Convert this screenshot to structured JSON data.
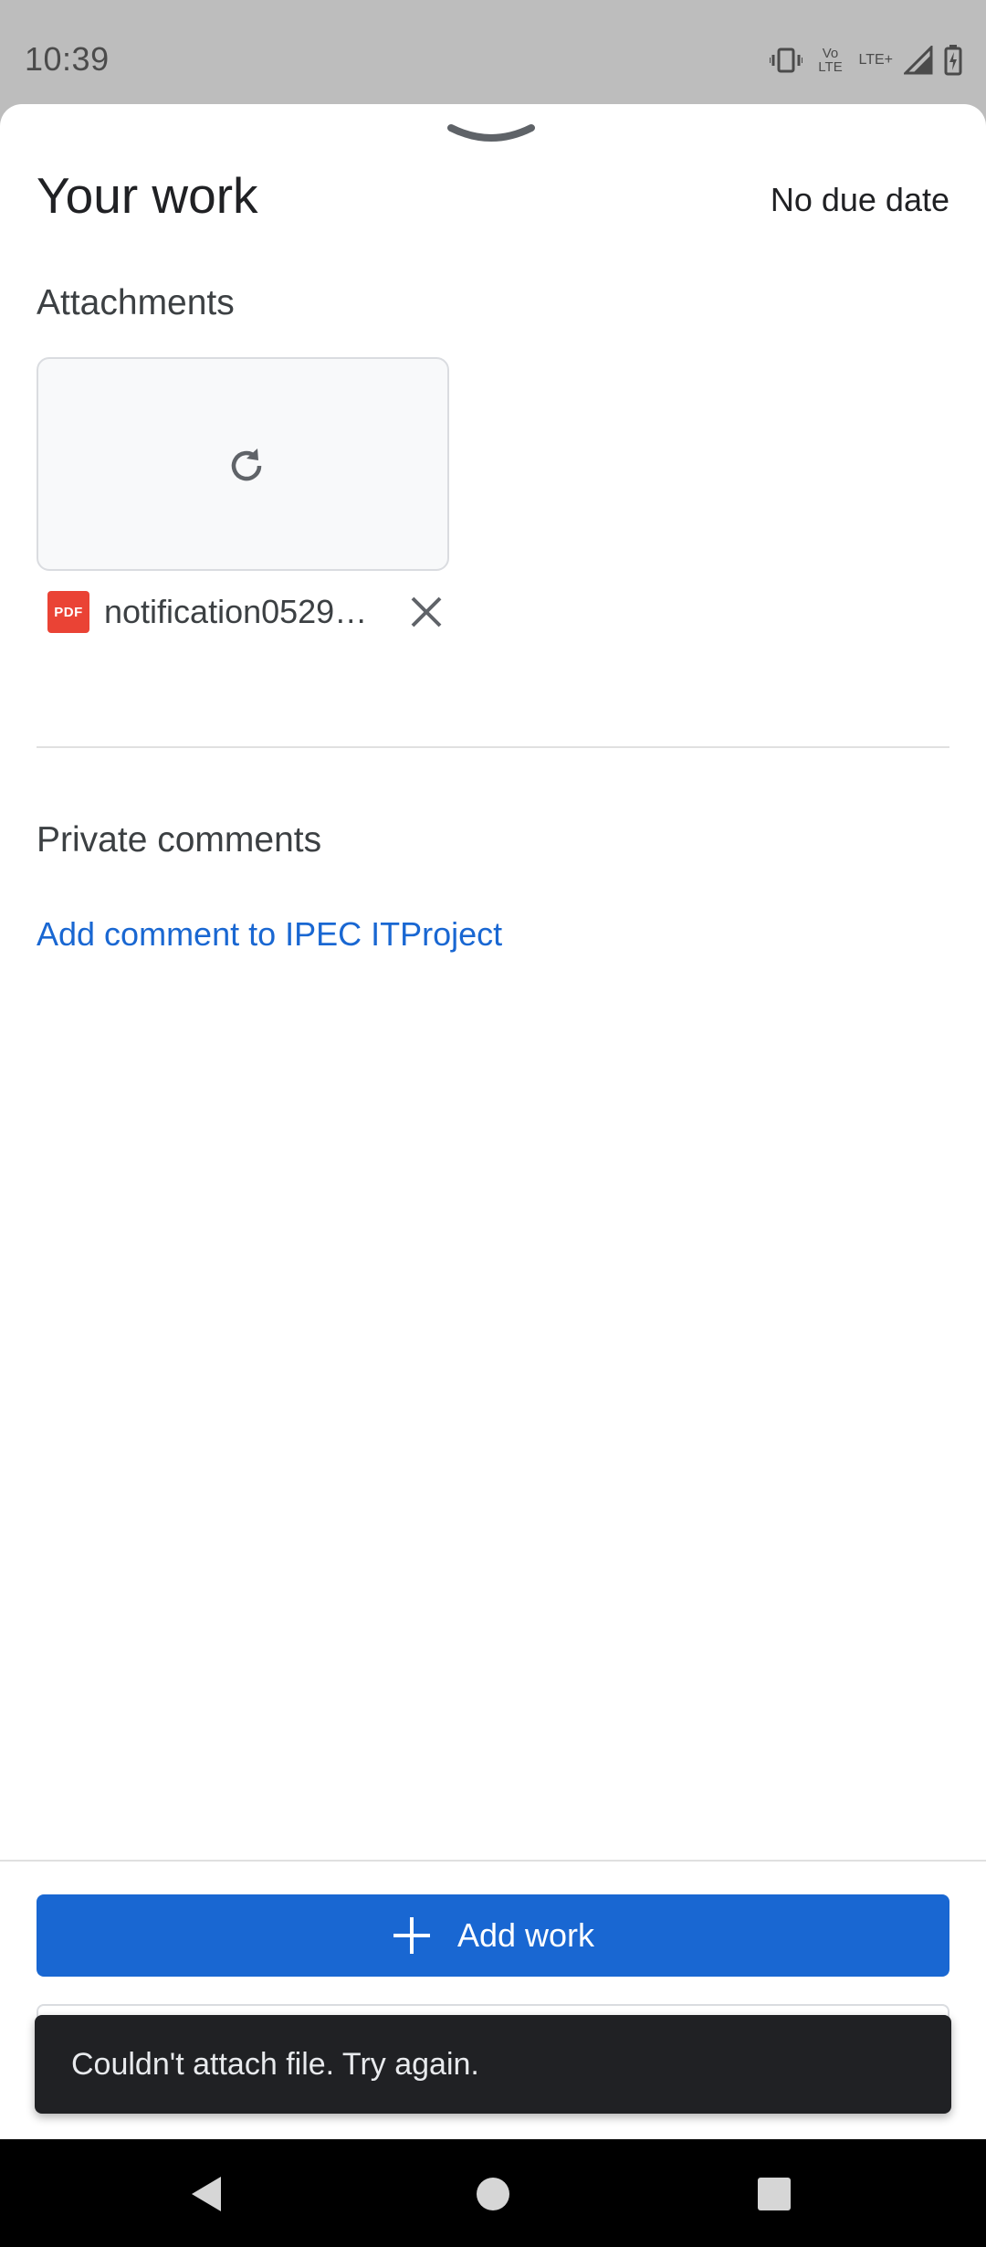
{
  "status_bar": {
    "time": "10:39",
    "icons": [
      "vibrate-icon",
      "volte-icon",
      "lte-plus-icon",
      "signal-icon",
      "battery-charging-icon"
    ],
    "volte_text": "Vo LTE",
    "lte_text": "LTE+"
  },
  "sheet": {
    "title": "Your work",
    "due_date": "No due date"
  },
  "attachments": {
    "heading": "Attachments",
    "files": [
      {
        "type_label": "PDF",
        "name": "notification05292…",
        "status_icon": "retry-icon"
      }
    ]
  },
  "comments": {
    "heading": "Private comments",
    "add_link": "Add comment to IPEC ITProject"
  },
  "actions": {
    "add_work_label": "Add work"
  },
  "snackbar": {
    "message": "Couldn't attach file. Try again."
  },
  "navigation": {
    "buttons": [
      "back-icon",
      "home-icon",
      "recents-icon"
    ]
  },
  "colors": {
    "accent": "#1967d2",
    "pdf_red": "#ea4335",
    "snackbar_bg": "#202124",
    "status_bar_bg": "#bdbdbd"
  }
}
